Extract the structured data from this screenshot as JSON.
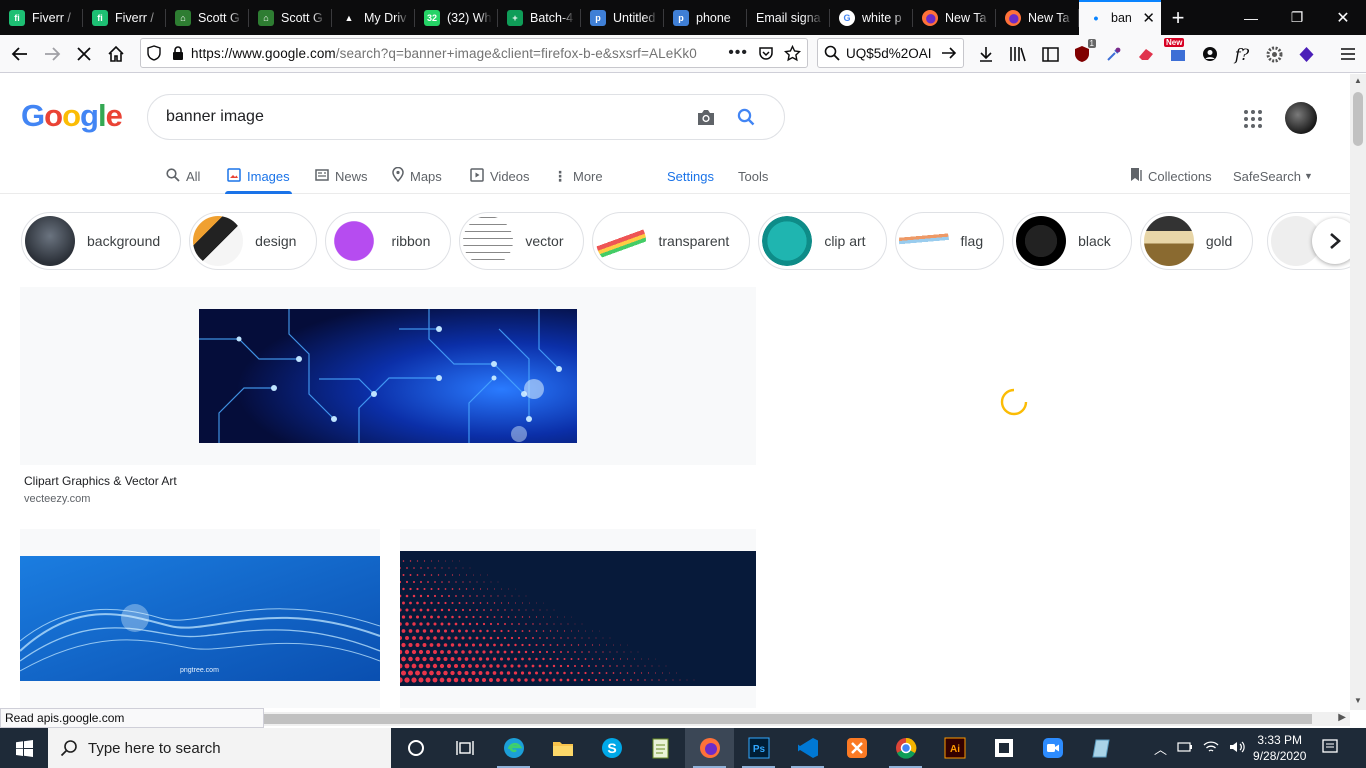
{
  "browser": {
    "tabs": [
      {
        "label": "Fiverr /",
        "fav": "fiverr-icon",
        "color": "#1dbf73",
        "glyph": "fi"
      },
      {
        "label": "Fiverr /",
        "fav": "fiverr-icon",
        "color": "#1dbf73",
        "glyph": "fi"
      },
      {
        "label": "Scott G",
        "fav": "house-icon",
        "color": "#2e7d32",
        "glyph": "⌂"
      },
      {
        "label": "Scott G",
        "fav": "house-icon",
        "color": "#2e7d32",
        "glyph": "⌂"
      },
      {
        "label": "My Driv",
        "fav": "google-drive-icon",
        "color": "#0c0c0d",
        "glyph": "▲"
      },
      {
        "label": "(32) Wh",
        "fav": "whatsapp-icon",
        "color": "#25d366",
        "glyph": "32"
      },
      {
        "label": "Batch-4",
        "fav": "sheets-icon",
        "color": "#0f9d58",
        "glyph": "+"
      },
      {
        "label": "Untitled",
        "fav": "pixlr-icon",
        "color": "#3f7fd6",
        "glyph": "p"
      },
      {
        "label": "phone",
        "fav": "pixlr-icon",
        "color": "#3f7fd6",
        "glyph": "p"
      },
      {
        "label": "Email signa",
        "fav": "",
        "color": "#0c0c0d",
        "glyph": ""
      },
      {
        "label": "white p",
        "fav": "google-icon",
        "color": "#ffffff",
        "glyph": "G"
      },
      {
        "label": "New Ta",
        "fav": "firefox-icon",
        "color": "#ff7139",
        "glyph": ""
      },
      {
        "label": "New Ta",
        "fav": "firefox-icon",
        "color": "#ff7139",
        "glyph": ""
      }
    ],
    "active_tab": {
      "label": "ban"
    },
    "url": {
      "main": "https://www.google.com",
      "rest": "/search?q=banner+image&client=firefox-b-e&sxsrf=ALeKk0"
    },
    "search_value": "UQ$5d%2OAI",
    "status_text": "Read apis.google.com",
    "ublock_count": "1",
    "new_badge": "New"
  },
  "google": {
    "logo": [
      "G",
      "o",
      "o",
      "g",
      "l",
      "e"
    ],
    "logo_colors": [
      "#4285f4",
      "#ea4335",
      "#fbbc05",
      "#4285f4",
      "#34a853",
      "#ea4335"
    ],
    "query": "banner image",
    "tabs": {
      "all": "All",
      "images": "Images",
      "news": "News",
      "maps": "Maps",
      "videos": "Videos",
      "more": "More",
      "settings": "Settings",
      "tools": "Tools",
      "collections": "Collections",
      "safesearch": "SafeSearch"
    },
    "chips": [
      {
        "label": "background"
      },
      {
        "label": "design"
      },
      {
        "label": "ribbon"
      },
      {
        "label": "vector"
      },
      {
        "label": "transparent"
      },
      {
        "label": "clip art"
      },
      {
        "label": "flag"
      },
      {
        "label": "black"
      },
      {
        "label": "gold"
      }
    ],
    "results": [
      {
        "title": "Clipart Graphics & Vector Art",
        "site": "vecteezy.com"
      },
      {
        "watermark": "pngtree.com"
      }
    ]
  },
  "taskbar": {
    "search_placeholder": "Type here to search",
    "time": "3:33 PM",
    "date": "9/28/2020"
  }
}
